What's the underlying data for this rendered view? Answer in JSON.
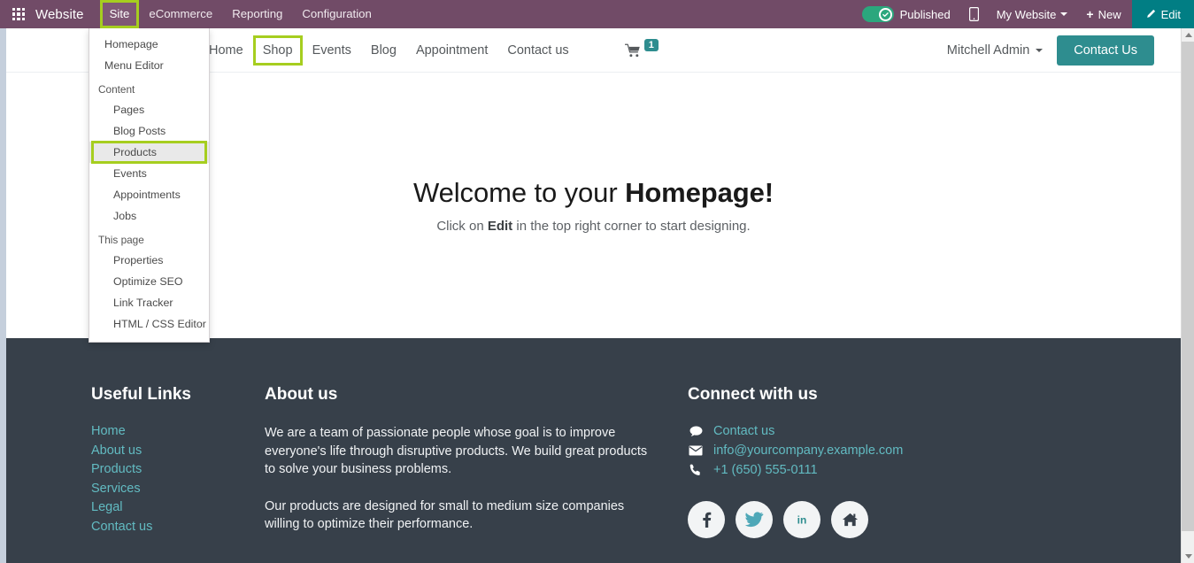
{
  "topbar": {
    "apps_icon": "apps-grid-icon",
    "brand": "Website",
    "menus": [
      {
        "label": "Site",
        "highlighted": true,
        "open": true
      },
      {
        "label": "eCommerce",
        "highlighted": false,
        "open": false
      },
      {
        "label": "Reporting",
        "highlighted": false,
        "open": false
      },
      {
        "label": "Configuration",
        "highlighted": false,
        "open": false
      }
    ],
    "published_label": "Published",
    "mobile_icon": "mobile-preview-icon",
    "website_selector": "My Website",
    "new_label": "New",
    "edit_label": "Edit",
    "bg_color": "#714B67",
    "edit_color": "#017e84",
    "toggle_color": "#2BA77D",
    "highlight_color": "#A6CE1F"
  },
  "dropdown": {
    "top_items": [
      "Homepage",
      "Menu Editor"
    ],
    "sections": [
      {
        "title": "Content",
        "items": [
          {
            "label": "Pages",
            "highlighted": false
          },
          {
            "label": "Blog Posts",
            "highlighted": false
          },
          {
            "label": "Products",
            "highlighted": true
          },
          {
            "label": "Events",
            "highlighted": false
          },
          {
            "label": "Appointments",
            "highlighted": false
          },
          {
            "label": "Jobs",
            "highlighted": false
          }
        ]
      },
      {
        "title": "This page",
        "items": [
          {
            "label": "Properties",
            "highlighted": false
          },
          {
            "label": "Optimize SEO",
            "highlighted": false
          },
          {
            "label": "Link Tracker",
            "highlighted": false
          },
          {
            "label": "HTML / CSS Editor",
            "highlighted": false
          }
        ]
      }
    ]
  },
  "site_header": {
    "nav": [
      {
        "label": "Home",
        "highlighted": false
      },
      {
        "label": "Shop",
        "highlighted": true
      },
      {
        "label": "Events",
        "highlighted": false
      },
      {
        "label": "Blog",
        "highlighted": false
      },
      {
        "label": "Appointment",
        "highlighted": false
      },
      {
        "label": "Contact us",
        "highlighted": false
      }
    ],
    "cart_icon": "shopping-cart-icon",
    "cart_count": "1",
    "user_name": "Mitchell Admin",
    "cta_label": "Contact Us",
    "cta_color": "#2E8D8F"
  },
  "hero": {
    "title_plain": "Welcome to your ",
    "title_bold": "Homepage!",
    "subtitle_pre": "Click on ",
    "subtitle_bold": "Edit",
    "subtitle_post": " in the top right corner to start designing."
  },
  "footer": {
    "bg_color": "#37404A",
    "link_color": "#62BBC2",
    "useful_links": {
      "title": "Useful Links",
      "items": [
        "Home",
        "About us",
        "Products",
        "Services",
        "Legal",
        "Contact us"
      ]
    },
    "about": {
      "title": "About us",
      "paragraph_1": "We are a team of passionate people whose goal is to improve everyone's life through disruptive products. We build great products to solve your business problems.",
      "paragraph_2": "Our products are designed for small to medium size companies willing to optimize their performance."
    },
    "connect": {
      "title": "Connect with us",
      "rows": [
        {
          "icon": "comment-icon",
          "label": "Contact us"
        },
        {
          "icon": "envelope-icon",
          "label": "info@yourcompany.example.com"
        },
        {
          "icon": "phone-icon",
          "label": "+1 (650) 555-0111"
        }
      ],
      "socials": [
        {
          "icon": "facebook-icon",
          "color": "#37404A"
        },
        {
          "icon": "twitter-icon",
          "color": "#4FA8B8"
        },
        {
          "icon": "linkedin-icon",
          "color": "#2E8D8F"
        },
        {
          "icon": "home-icon",
          "color": "#37404A"
        }
      ]
    }
  },
  "scrollbar": {
    "up_arrow": "scroll-up-arrow",
    "down_arrow": "scroll-down-arrow"
  }
}
